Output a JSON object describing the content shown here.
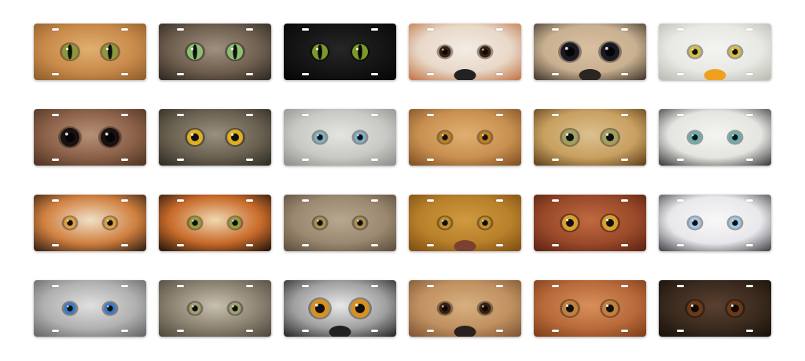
{
  "plates": [
    {
      "icon": "cat-eyes-icon",
      "bg": "#c88a4a",
      "bg2": "#8a5a2a",
      "fur": "#e0b070",
      "iris": "#8a9a3a",
      "pupil": "#101010",
      "pupil_shape": "slit",
      "eye": "round",
      "nose": ""
    },
    {
      "icon": "tabby-cat-eyes-icon",
      "bg": "#6e5e4e",
      "bg2": "#2a2520",
      "fur": "#a09080",
      "iris": "#8cc070",
      "pupil": "#101010",
      "pupil_shape": "slit",
      "eye": "round",
      "nose": ""
    },
    {
      "icon": "black-cat-eyes-icon",
      "bg": "#141414",
      "bg2": "#050505",
      "fur": "#262626",
      "iris": "#7a9a2a",
      "pupil": "#050505",
      "pupil_shape": "slit",
      "eye": "round",
      "nose": ""
    },
    {
      "icon": "dog-eyes-icon",
      "bg": "#e8d8c8",
      "bg2": "#c07040",
      "fur": "#f4ece4",
      "iris": "#3a2010",
      "pupil": "#100805",
      "pupil_shape": "round",
      "eye": "small",
      "nose": "#222222"
    },
    {
      "icon": "pug-eyes-icon",
      "bg": "#c8b090",
      "bg2": "#3a3028",
      "fur": "#d8c0a0",
      "iris": "#1a1a24",
      "pupil": "#050505",
      "pupil_shape": "round",
      "eye": "big",
      "nose": "#2a2520"
    },
    {
      "icon": "eagle-eyes-icon",
      "bg": "#e8e8e4",
      "bg2": "#b8b8b0",
      "fur": "#f4f4f0",
      "iris": "#d8c040",
      "pupil": "#101010",
      "pupil_shape": "round",
      "eye": "small",
      "nose": "#f0a020"
    },
    {
      "icon": "owl-eyes-icon",
      "bg": "#8a6048",
      "bg2": "#4a3020",
      "fur": "#b89078",
      "iris": "#1a1010",
      "pupil": "#050505",
      "pupil_shape": "round",
      "eye": "big",
      "nose": ""
    },
    {
      "icon": "great-horned-owl-eyes-icon",
      "bg": "#6a6050",
      "bg2": "#2a2820",
      "fur": "#9a9080",
      "iris": "#e0b020",
      "pupil": "#101010",
      "pupil_shape": "round",
      "eye": "round",
      "nose": ""
    },
    {
      "icon": "snow-leopard-eyes-icon",
      "bg": "#c8c8c4",
      "bg2": "#8a8a88",
      "fur": "#e4e4e0",
      "iris": "#7ab0c8",
      "pupil": "#101010",
      "pupil_shape": "round",
      "eye": "small",
      "nose": ""
    },
    {
      "icon": "cheetah-eyes-icon",
      "bg": "#c89050",
      "bg2": "#7a4a20",
      "fur": "#e0b070",
      "iris": "#c08020",
      "pupil": "#101010",
      "pupil_shape": "round",
      "eye": "small",
      "nose": ""
    },
    {
      "icon": "leopard-eyes-icon",
      "bg": "#c8a060",
      "bg2": "#5a3a18",
      "fur": "#dcc090",
      "iris": "#a0a060",
      "pupil": "#101010",
      "pupil_shape": "round",
      "eye": "round",
      "nose": ""
    },
    {
      "icon": "white-tiger-eyes-icon",
      "bg": "#e4e4e0",
      "bg2": "#303030",
      "fur": "#f4f4f0",
      "iris": "#60b0b0",
      "pupil": "#101010",
      "pupil_shape": "round",
      "eye": "small",
      "nose": ""
    },
    {
      "icon": "tiger-eyes-icon",
      "bg": "#d08040",
      "bg2": "#2a1a10",
      "fur": "#f0e0c8",
      "iris": "#e0a040",
      "pupil": "#101010",
      "pupil_shape": "round",
      "eye": "small",
      "nose": ""
    },
    {
      "icon": "bengal-tiger-eyes-icon",
      "bg": "#c86a2a",
      "bg2": "#1a1008",
      "fur": "#f0d8b0",
      "iris": "#90a040",
      "pupil": "#101010",
      "pupil_shape": "round",
      "eye": "small",
      "nose": ""
    },
    {
      "icon": "lynx-eyes-icon",
      "bg": "#9a8870",
      "bg2": "#5a4a38",
      "fur": "#b8a890",
      "iris": "#b09050",
      "pupil": "#101010",
      "pupil_shape": "round",
      "eye": "small",
      "nose": ""
    },
    {
      "icon": "lion-eyes-icon",
      "bg": "#b8802a",
      "bg2": "#7a4a10",
      "fur": "#d09a40",
      "iris": "#c09030",
      "pupil": "#101010",
      "pupil_shape": "round",
      "eye": "small",
      "nose": "#7a4030"
    },
    {
      "icon": "cougar-eyes-icon",
      "bg": "#9a4a2a",
      "bg2": "#5a2010",
      "fur": "#c06a40",
      "iris": "#d8a030",
      "pupil": "#101010",
      "pupil_shape": "round",
      "eye": "round",
      "nose": ""
    },
    {
      "icon": "husky-eyes-icon",
      "bg": "#e8e8ec",
      "bg2": "#3a3a40",
      "fur": "#f8f8f8",
      "iris": "#a0c8e8",
      "pupil": "#101010",
      "pupil_shape": "round",
      "eye": "small",
      "nose": ""
    },
    {
      "icon": "wolf-blue-eyes-icon",
      "bg": "#b0b0b0",
      "bg2": "#606060",
      "fur": "#e0e0e0",
      "iris": "#3a7ac8",
      "pupil": "#101010",
      "pupil_shape": "round",
      "eye": "small",
      "nose": ""
    },
    {
      "icon": "grey-wolf-eyes-icon",
      "bg": "#8a8070",
      "bg2": "#4a4438",
      "fur": "#c8c0b0",
      "iris": "#a0a070",
      "pupil": "#101010",
      "pupil_shape": "round",
      "eye": "small",
      "nose": ""
    },
    {
      "icon": "lemur-eyes-icon",
      "bg": "#a0a0a0",
      "bg2": "#202020",
      "fur": "#e8e8e8",
      "iris": "#d89020",
      "pupil": "#101010",
      "pupil_shape": "round",
      "eye": "big",
      "nose": "#202020"
    },
    {
      "icon": "bear-eyes-icon",
      "bg": "#c09060",
      "bg2": "#7a5030",
      "fur": "#d8b080",
      "iris": "#3a2010",
      "pupil": "#100805",
      "pupil_shape": "round",
      "eye": "small",
      "nose": "#2a2020"
    },
    {
      "icon": "fox-eyes-icon",
      "bg": "#b86a3a",
      "bg2": "#7a3a18",
      "fur": "#d8905a",
      "iris": "#c08040",
      "pupil": "#101010",
      "pupil_shape": "round",
      "eye": "round",
      "nose": ""
    },
    {
      "icon": "chimpanzee-eyes-icon",
      "bg": "#3a2a1e",
      "bg2": "#151008",
      "fur": "#5a4030",
      "iris": "#6a3a18",
      "pupil": "#100805",
      "pupil_shape": "round",
      "eye": "round",
      "nose": ""
    }
  ]
}
